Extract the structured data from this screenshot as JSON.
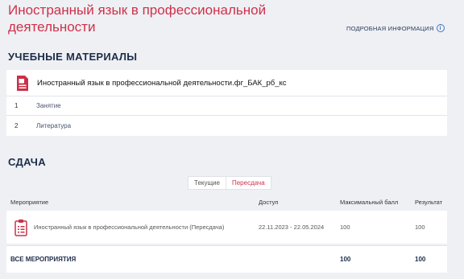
{
  "header": {
    "title": "Иностранный язык в профессиональной деятельности",
    "more_info": "ПОДРОБНАЯ ИНФОРМАЦИЯ",
    "info_glyph": "i"
  },
  "materials": {
    "heading": "УЧЕБНЫЕ МАТЕРИАЛЫ",
    "name": "Иностранный язык в профессиональной деятельности.фг_БАК_рб_кс",
    "items": [
      {
        "num": "1",
        "label": "Занятие"
      },
      {
        "num": "2",
        "label": "Литература"
      }
    ]
  },
  "submission": {
    "heading": "СДАЧА",
    "tabs": [
      {
        "label": "Текущие",
        "active": false
      },
      {
        "label": "Пересдача",
        "active": true
      }
    ],
    "columns": {
      "event": "Мероприятие",
      "access": "Доступ",
      "max": "Максимальный балл",
      "result": "Результат"
    },
    "rows": [
      {
        "event": "Иностранный язык в профессиональной деятельности (Пересдача)",
        "access": "22.11.2023 - 22.05.2024",
        "max": "100",
        "result": "100"
      }
    ],
    "total": {
      "label": "ВСЕ МЕРОПРИЯТИЯ",
      "max": "100",
      "result": "100"
    }
  },
  "colors": {
    "accent": "#d0304a",
    "navy": "#1e2d4a",
    "link": "#3a79c7"
  }
}
